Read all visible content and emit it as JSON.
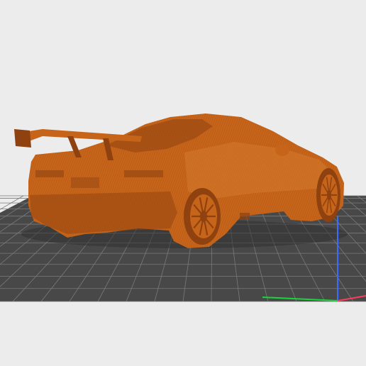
{
  "viewport": {
    "background": "#ececec",
    "model_color": "#c6641a",
    "model_shadow": "#8f4210",
    "model_highlight": "#e08a3a",
    "grid_fill": "#484848",
    "grid_line": "#7a7a7a",
    "axis_x_color": "#ff3b5c",
    "axis_y_color": "#19d63a",
    "axis_z_color": "#3a6cff"
  }
}
